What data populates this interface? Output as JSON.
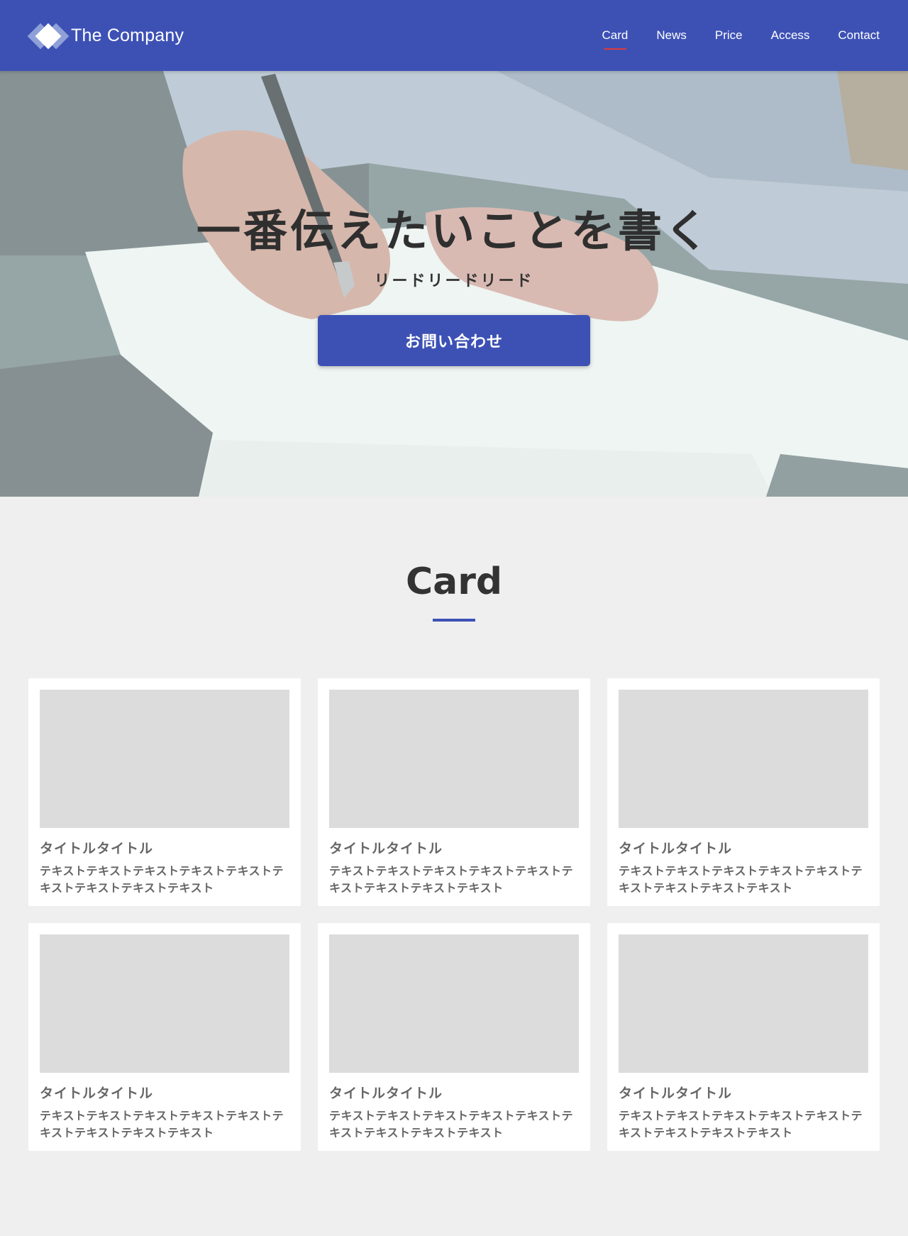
{
  "header": {
    "logo_text": "The Company",
    "nav": [
      {
        "label": "Card",
        "active": true
      },
      {
        "label": "News",
        "active": false
      },
      {
        "label": "Price",
        "active": false
      },
      {
        "label": "Access",
        "active": false
      },
      {
        "label": "Contact",
        "active": false
      }
    ]
  },
  "hero": {
    "title": "一番伝えたいことを書く",
    "lead": "リードリードリード",
    "button_label": "お問い合わせ"
  },
  "card_section": {
    "title": "Card",
    "cards": [
      {
        "title": "タイトルタイトル",
        "text": "テキストテキストテキストテキストテキストテキストテキストテキストテキスト"
      },
      {
        "title": "タイトルタイトル",
        "text": "テキストテキストテキストテキストテキストテキストテキストテキストテキスト"
      },
      {
        "title": "タイトルタイトル",
        "text": "テキストテキストテキストテキストテキストテキストテキストテキストテキスト"
      },
      {
        "title": "タイトルタイトル",
        "text": "テキストテキストテキストテキストテキストテキストテキストテキストテキスト"
      },
      {
        "title": "タイトルタイトル",
        "text": "テキストテキストテキストテキストテキストテキストテキストテキストテキスト"
      },
      {
        "title": "タイトルタイトル",
        "text": "テキストテキストテキストテキストテキストテキストテキストテキストテキスト"
      }
    ]
  },
  "colors": {
    "primary": "#3d51b5",
    "nav_active_underline": "#d93a3a",
    "page_background": "#efefef",
    "card_image_placeholder": "#dcdcdc"
  }
}
